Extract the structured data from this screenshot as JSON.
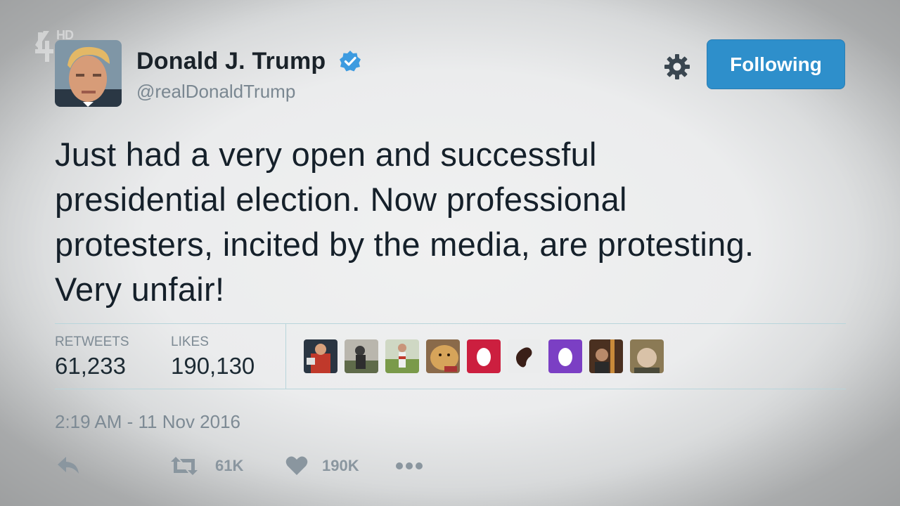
{
  "channel": {
    "hd_label": "HD"
  },
  "tweet": {
    "author_name": "Donald J. Trump",
    "author_handle": "@realDonaldTrump",
    "follow_button_label": "Following",
    "text_lines": [
      "Just had a very open and successful",
      "presidential election. Now professional",
      "protesters, incited by the media, are protesting.",
      "Very unfair!"
    ],
    "stats": {
      "retweets_label": "RETWEETS",
      "retweets_value": "61,233",
      "likes_label": "LIKES",
      "likes_value": "190,130"
    },
    "likers": [
      {
        "icon": "user-avatar-red-jacket"
      },
      {
        "icon": "user-avatar-outdoor"
      },
      {
        "icon": "user-avatar-field"
      },
      {
        "icon": "user-avatar-animal"
      },
      {
        "icon": "default-egg-avatar-red",
        "color": "#cc1f3f"
      },
      {
        "icon": "bean-avatar"
      },
      {
        "icon": "default-egg-avatar-purple",
        "color": "#7b3fc4"
      },
      {
        "icon": "user-avatar-room"
      },
      {
        "icon": "user-avatar-face"
      }
    ],
    "timestamp": "2:19 AM - 11 Nov 2016",
    "actions": {
      "retweet_count": "61K",
      "like_count": "190K"
    }
  },
  "colors": {
    "follow_button": "#2e8fcb",
    "verified_badge": "#3d9be0",
    "divider": "#b8d5db"
  }
}
